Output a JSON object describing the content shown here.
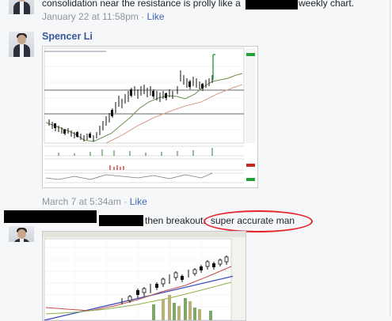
{
  "comment1": {
    "text_before": "consolidation near the resistance is prolly like a",
    "text_after": "weekly chart.",
    "timestamp": "January 22 at 11:58pm",
    "separator": "·",
    "like_label": "Like"
  },
  "comment2": {
    "author": "Spencer Li",
    "timestamp": "March 7 at 5:34am",
    "separator": "·",
    "like_label": "Like"
  },
  "comment3": {
    "text_mid": "then breakout.",
    "text_circled": "super accurate man"
  },
  "colors": {
    "link": "#365899",
    "meta": "#90949c",
    "annotation_circle": "#e3262c",
    "redaction": "#000000"
  },
  "icons": {
    "avatar": "profile-photo"
  }
}
